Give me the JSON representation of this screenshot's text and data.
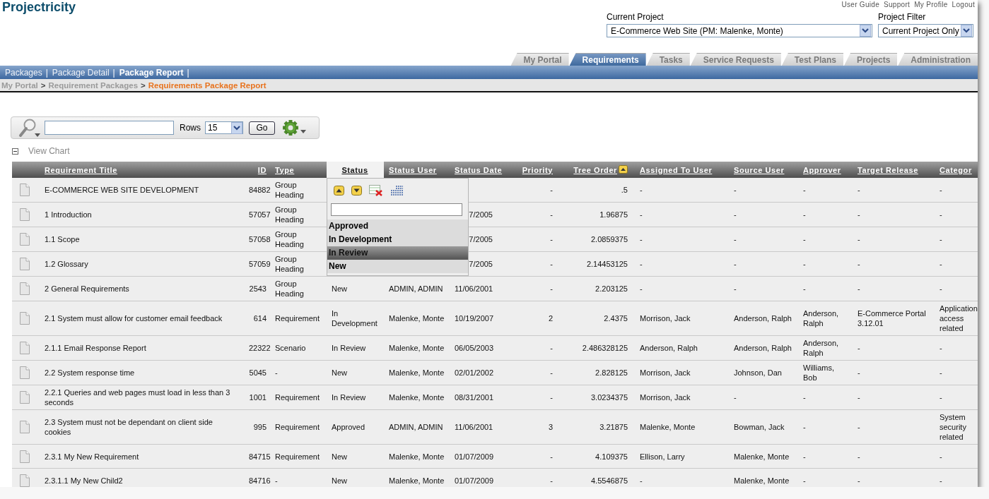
{
  "header": {
    "app_title": "Projectricity",
    "user_links": [
      "User Guide",
      "Support",
      "My Profile",
      "Logout"
    ],
    "current_project": {
      "label": "Current Project",
      "value": "E-Commerce Web Site (PM: Malenke, Monte)"
    },
    "project_filter": {
      "label": "Project Filter",
      "value": "Current Project Only"
    }
  },
  "main_tabs": [
    {
      "label": "My Portal",
      "selected": false
    },
    {
      "label": "Requirements",
      "selected": true
    },
    {
      "label": "Tasks",
      "selected": false
    },
    {
      "label": "Service Requests",
      "selected": false
    },
    {
      "label": "Test Plans",
      "selected": false
    },
    {
      "label": "Projects",
      "selected": false
    },
    {
      "label": "Administration",
      "selected": false
    }
  ],
  "sub_nav": {
    "separator": "|",
    "items": [
      {
        "label": "Packages",
        "selected": false
      },
      {
        "label": "Package Detail",
        "selected": false
      },
      {
        "label": "Package Report",
        "selected": true
      }
    ]
  },
  "breadcrumb": {
    "separator": ">",
    "items": [
      {
        "label": "My Portal",
        "current": false
      },
      {
        "label": "Requirement Packages",
        "current": false
      },
      {
        "label": "Requirements Package Report",
        "current": true
      }
    ]
  },
  "toolbar": {
    "rows_label": "Rows",
    "rows_value": "15",
    "go_button": "Go"
  },
  "view_chart": {
    "label": "View Chart",
    "expanded": true
  },
  "table": {
    "columns": [
      {
        "label": "Requirement Title",
        "kind": "text",
        "active": false,
        "sorted": false
      },
      {
        "label": "ID",
        "kind": "number",
        "active": false,
        "sorted": false
      },
      {
        "label": "Type",
        "kind": "text",
        "active": false,
        "sorted": false
      },
      {
        "label": "Status",
        "kind": "text",
        "active": true,
        "sorted": false
      },
      {
        "label": "Status User",
        "kind": "text",
        "active": false,
        "sorted": false
      },
      {
        "label": "Status Date",
        "kind": "date",
        "active": false,
        "sorted": false
      },
      {
        "label": "Priority",
        "kind": "number",
        "active": false,
        "sorted": false
      },
      {
        "label": "Tree Order",
        "kind": "number",
        "active": false,
        "sorted": true
      },
      {
        "label": "Assigned To User",
        "kind": "text",
        "active": false,
        "sorted": false
      },
      {
        "label": "Source User",
        "kind": "text",
        "active": false,
        "sorted": false
      },
      {
        "label": "Approver",
        "kind": "text",
        "active": false,
        "sorted": false
      },
      {
        "label": "Target Release",
        "kind": "text",
        "active": false,
        "sorted": false
      },
      {
        "label": "Categor",
        "kind": "text",
        "active": false,
        "sorted": false
      }
    ],
    "rows": [
      {
        "cells": [
          "E-COMMERCE WEB SITE DEVELOPMENT",
          "84882",
          "Group Heading",
          null,
          null,
          null,
          "-",
          ".5",
          "-",
          "-",
          "-",
          "-",
          "-"
        ]
      },
      {
        "cells": [
          "1 Introduction",
          "57057",
          "Group Heading",
          null,
          null,
          "7/2005",
          "-",
          "1.96875",
          "-",
          "-",
          "-",
          "-",
          "-"
        ]
      },
      {
        "cells": [
          "1.1 Scope",
          "57058",
          "Group Heading",
          null,
          null,
          "7/2005",
          "-",
          "2.0859375",
          "-",
          "-",
          "-",
          "-",
          "-"
        ]
      },
      {
        "cells": [
          "1.2 Glossary",
          "57059",
          "Group Heading",
          null,
          null,
          "7/2005",
          "-",
          "2.14453125",
          "-",
          "-",
          "-",
          "-",
          "-"
        ]
      },
      {
        "cells": [
          "2 General Requirements",
          "2543",
          "Group Heading",
          "New",
          "ADMIN, ADMIN",
          "11/06/2001",
          "-",
          "2.203125",
          "-",
          "-",
          "-",
          "-",
          "-"
        ]
      },
      {
        "cells": [
          "2.1 System must allow for customer email feedback",
          "614",
          "Requirement",
          "In Development",
          "Malenke, Monte",
          "10/19/2007",
          "2",
          "2.4375",
          "Morrison, Jack",
          "Anderson, Ralph",
          "Anderson, Ralph",
          "E-Commerce Portal 3.12.01",
          "Application access related"
        ]
      },
      {
        "cells": [
          "2.1.1 Email Response Report",
          "22322",
          "Scenario",
          "In Review",
          "Malenke, Monte",
          "06/05/2003",
          "-",
          "2.486328125",
          "Anderson, Ralph",
          "Anderson, Ralph",
          "Anderson, Ralph",
          "-",
          "-"
        ]
      },
      {
        "cells": [
          "2.2 System response time",
          "5045",
          "-",
          "New",
          "Malenke, Monte",
          "02/01/2002",
          "-",
          "2.828125",
          "Morrison, Jack",
          "Johnson, Dan",
          "Williams, Bob",
          "-",
          "-"
        ]
      },
      {
        "cells": [
          "2.2.1 Queries and web pages must load in less than 3 seconds",
          "1001",
          "Requirement",
          "In Review",
          "Malenke, Monte",
          "08/31/2001",
          "-",
          "3.0234375",
          "Morrison, Jack",
          "-",
          "-",
          "-",
          "-"
        ]
      },
      {
        "cells": [
          "2.3 System must not be dependant on client side cookies",
          "995",
          "Requirement",
          "Approved",
          "ADMIN, ADMIN",
          "11/06/2001",
          "3",
          "3.21875",
          "Malenke, Monte",
          "Bowman, Jack",
          "-",
          "-",
          "System security related"
        ]
      },
      {
        "cells": [
          "2.3.1 My New Requirement",
          "84715",
          "Requirement",
          "New",
          "Malenke, Monte",
          "01/07/2009",
          "-",
          "4.109375",
          "Ellison, Larry",
          "Malenke, Monte",
          "-",
          "-",
          "-"
        ]
      },
      {
        "cells": [
          "2.3.1.1 My New Child2",
          "84716",
          "-",
          "New",
          "Malenke, Monte",
          "01/07/2009",
          "-",
          "4.5546875",
          "-",
          "Malenke, Monte",
          "-",
          "-",
          "-"
        ]
      }
    ],
    "status_menu": {
      "options": [
        {
          "label": "Approved",
          "selected": false
        },
        {
          "label": "In Development",
          "selected": false
        },
        {
          "label": "In Review",
          "selected": true
        },
        {
          "label": "New",
          "selected": false
        }
      ]
    }
  }
}
